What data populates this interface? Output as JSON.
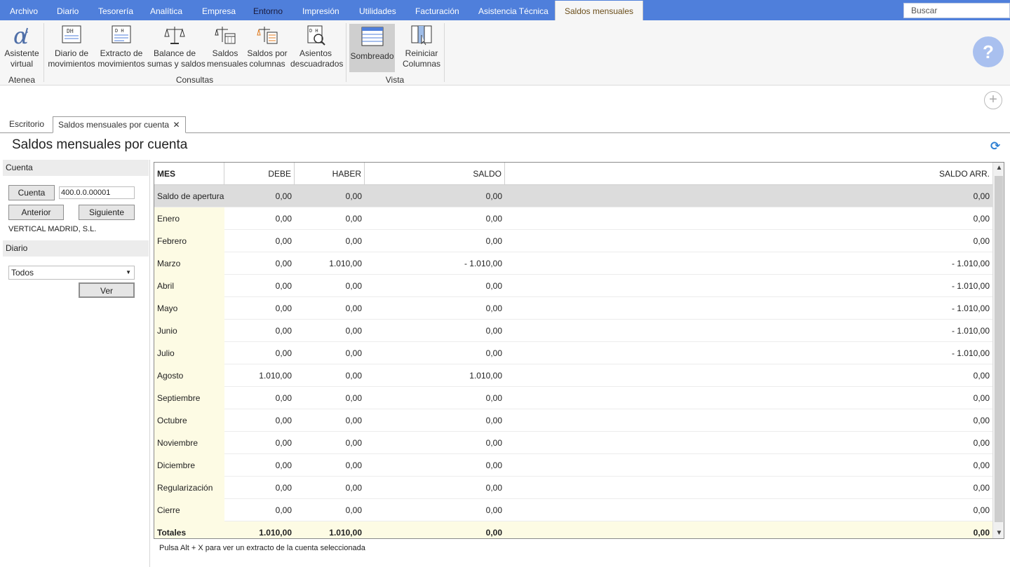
{
  "menu": {
    "items": [
      {
        "label": "Archivo"
      },
      {
        "label": "Diario"
      },
      {
        "label": "Tesorería"
      },
      {
        "label": "Analítica"
      },
      {
        "label": "Empresa"
      },
      {
        "label": "Entorno"
      },
      {
        "label": "Impresión"
      },
      {
        "label": "Utilidades"
      },
      {
        "label": "Facturación"
      },
      {
        "label": "Asistencia Técnica"
      },
      {
        "label": "Saldos mensuales"
      }
    ],
    "active": "Saldos mensuales",
    "search_placeholder": "Buscar"
  },
  "ribbon": {
    "buttons": [
      {
        "line1": "Asistente",
        "line2": "virtual",
        "icon": "alpha-icon"
      },
      {
        "line1": "Diario de",
        "line2": "movimientos",
        "icon": "journal-icon"
      },
      {
        "line1": "Extracto de",
        "line2": "movimientos",
        "icon": "statement-icon"
      },
      {
        "line1": "Balance de",
        "line2": "sumas y saldos",
        "icon": "balance-scale-icon"
      },
      {
        "line1": "Saldos",
        "line2": "mensuales",
        "icon": "monthly-balance-icon"
      },
      {
        "line1": "Saldos por",
        "line2": "columnas",
        "icon": "column-balance-icon"
      },
      {
        "line1": "Asientos",
        "line2": "descuadrados",
        "icon": "unbalanced-entries-icon"
      },
      {
        "line1": "Sombreado",
        "line2": "",
        "icon": "shading-icon"
      },
      {
        "line1": "Reiniciar",
        "line2": "Columnas",
        "icon": "reset-columns-icon"
      }
    ],
    "groups": [
      "Atenea",
      "Consultas",
      "Vista"
    ]
  },
  "tabs": [
    {
      "label": "Escritorio"
    },
    {
      "label": "Saldos mensuales por cuenta",
      "close": "✕"
    }
  ],
  "page": {
    "title": "Saldos mensuales por cuenta"
  },
  "left": {
    "cuenta_header": "Cuenta",
    "cuenta_button": "Cuenta",
    "cuenta_value": "400.0.0.00001",
    "anterior": "Anterior",
    "siguiente": "Siguiente",
    "company": "VERTICAL MADRID, S.L.",
    "diario_header": "Diario",
    "diario_value": "Todos",
    "ver": "Ver"
  },
  "table": {
    "columns": [
      "MES",
      "DEBE",
      "HABER",
      "SALDO",
      "SALDO ARR."
    ],
    "rows": [
      [
        "Saldo de apertura",
        "0,00",
        "0,00",
        "0,00",
        "0,00"
      ],
      [
        "Enero",
        "0,00",
        "0,00",
        "0,00",
        "0,00"
      ],
      [
        "Febrero",
        "0,00",
        "0,00",
        "0,00",
        "0,00"
      ],
      [
        "Marzo",
        "0,00",
        "1.010,00",
        "- 1.010,00",
        "- 1.010,00"
      ],
      [
        "Abril",
        "0,00",
        "0,00",
        "0,00",
        "- 1.010,00"
      ],
      [
        "Mayo",
        "0,00",
        "0,00",
        "0,00",
        "- 1.010,00"
      ],
      [
        "Junio",
        "0,00",
        "0,00",
        "0,00",
        "- 1.010,00"
      ],
      [
        "Julio",
        "0,00",
        "0,00",
        "0,00",
        "- 1.010,00"
      ],
      [
        "Agosto",
        "1.010,00",
        "0,00",
        "1.010,00",
        "0,00"
      ],
      [
        "Septiembre",
        "0,00",
        "0,00",
        "0,00",
        "0,00"
      ],
      [
        "Octubre",
        "0,00",
        "0,00",
        "0,00",
        "0,00"
      ],
      [
        "Noviembre",
        "0,00",
        "0,00",
        "0,00",
        "0,00"
      ],
      [
        "Diciembre",
        "0,00",
        "0,00",
        "0,00",
        "0,00"
      ],
      [
        "Regularización",
        "0,00",
        "0,00",
        "0,00",
        "0,00"
      ],
      [
        "Cierre",
        "0,00",
        "0,00",
        "0,00",
        "0,00"
      ]
    ],
    "totals": [
      "Totales",
      "1.010,00",
      "1.010,00",
      "0,00",
      "0,00"
    ]
  },
  "hint": "Pulsa Alt + X para ver un extracto de la cuenta seleccionada"
}
